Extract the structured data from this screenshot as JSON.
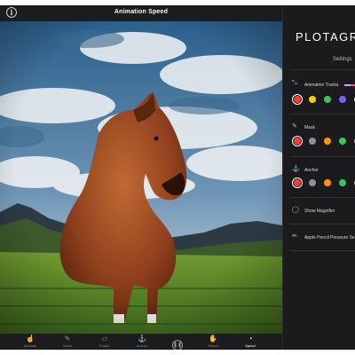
{
  "app": {
    "title": "Animation Speed"
  },
  "toolbar": {
    "items": [
      {
        "label": "Animate",
        "icon": "hand-pointer-icon"
      },
      {
        "label": "Mask",
        "icon": "pen-icon"
      },
      {
        "label": "Eraser",
        "icon": "eraser-icon"
      },
      {
        "label": "Anchor",
        "icon": "anchor-icon"
      },
      {
        "label": "",
        "icon": "pause-icon"
      },
      {
        "label": "Select",
        "icon": "hand-icon"
      },
      {
        "label": "Speed",
        "icon": "speedometer-icon"
      }
    ]
  },
  "sidebar": {
    "logo": "PLOTAGRA",
    "heading": "Settings",
    "animation_tracks": {
      "label": "Animation Tracks",
      "colors": [
        "#ff3b30",
        "#ffcc00",
        "#34c759",
        "#7b5cff",
        "#eeeeee"
      ]
    },
    "mask": {
      "label": "Mask",
      "colors": [
        "#ff3b30",
        "#8e8e93",
        "#ff9500",
        "#34c759",
        "#5ac8fa"
      ]
    },
    "anchor": {
      "label": "Anchor",
      "colors": [
        "#ff3b30",
        "#8e8e93",
        "#ff9500",
        "#34c759",
        "#5ac8fa"
      ]
    },
    "magnifier": {
      "label": "Show Magnifier"
    },
    "pencil": {
      "label": "Apple Pencil Pressure Se"
    }
  }
}
